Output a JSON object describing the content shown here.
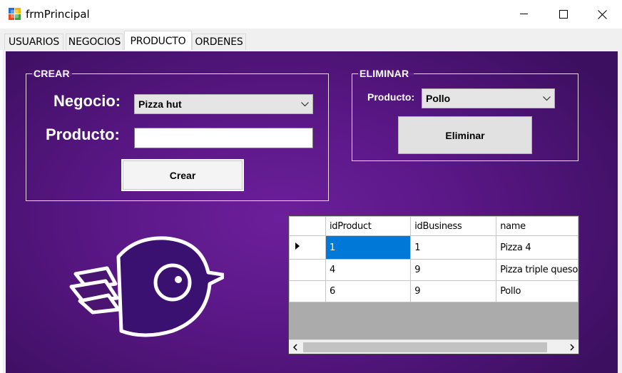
{
  "window": {
    "title": "frmPrincipal",
    "minimize_icon": "minimize-icon",
    "maximize_icon": "maximize-icon",
    "close_icon": "close-icon"
  },
  "tabs": [
    {
      "label": "USUARIOS",
      "active": false
    },
    {
      "label": "NEGOCIOS",
      "active": false
    },
    {
      "label": "PRODUCTO",
      "active": true
    },
    {
      "label": "ORDENES",
      "active": false
    }
  ],
  "crear": {
    "legend": "CREAR",
    "negocio_label": "Negocio:",
    "negocio_value": "Pizza hut",
    "producto_label": "Producto:",
    "producto_value": "",
    "crear_button": "Crear"
  },
  "eliminar": {
    "legend": "ELIMINAR",
    "producto_label": "Producto:",
    "producto_value": "Pollo",
    "eliminar_button": "Eliminar"
  },
  "grid": {
    "columns": [
      "idProduct",
      "idBusiness",
      "name"
    ],
    "rows": [
      [
        "1",
        "1",
        "Pizza 4"
      ],
      [
        "4",
        "9",
        "Pizza triple queso"
      ],
      [
        "6",
        "9",
        "Pollo"
      ]
    ],
    "selected_row": 0
  },
  "colors": {
    "panel_purple": "#5a1786",
    "selection_blue": "#0078d7"
  },
  "logo_icon": "bird-logo-icon"
}
